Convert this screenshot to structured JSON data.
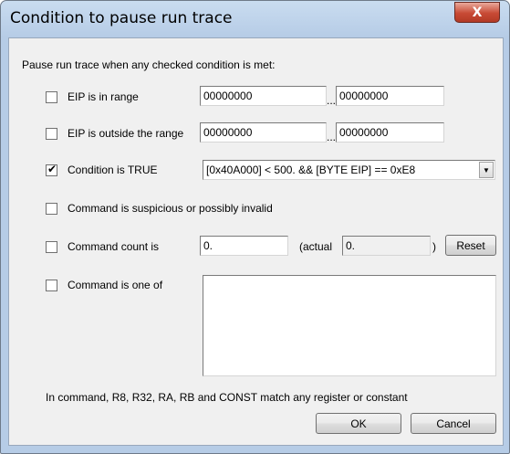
{
  "window": {
    "title": "Condition to pause run trace",
    "close_glyph": "X"
  },
  "intro": "Pause run trace when any checked condition is met:",
  "conditions": {
    "eip_in_range": {
      "label": "EIP is in range",
      "checked": false,
      "from": "00000000",
      "sep": "...",
      "to": "00000000"
    },
    "eip_outside": {
      "label": "EIP is outside the range",
      "checked": false,
      "from": "00000000",
      "sep": "...",
      "to": "00000000"
    },
    "cond_true": {
      "label": "Condition is TRUE",
      "checked": true,
      "check_glyph": "✔",
      "expression": "[0x40A000] < 500. && [BYTE EIP] == 0xE8",
      "dropdown_glyph": "▼"
    },
    "suspicious": {
      "label": "Command is suspicious or possibly invalid",
      "checked": false
    },
    "count": {
      "label": "Command count is",
      "checked": false,
      "value": "0.",
      "actual_prefix": "(actual",
      "actual_value": "0.",
      "actual_suffix": ")",
      "reset_label": "Reset"
    },
    "one_of": {
      "label": "Command is one of",
      "checked": false,
      "list": ""
    }
  },
  "footnote": "In command, R8, R32, RA, RB and CONST match any register or constant",
  "buttons": {
    "ok": "OK",
    "cancel": "Cancel"
  }
}
